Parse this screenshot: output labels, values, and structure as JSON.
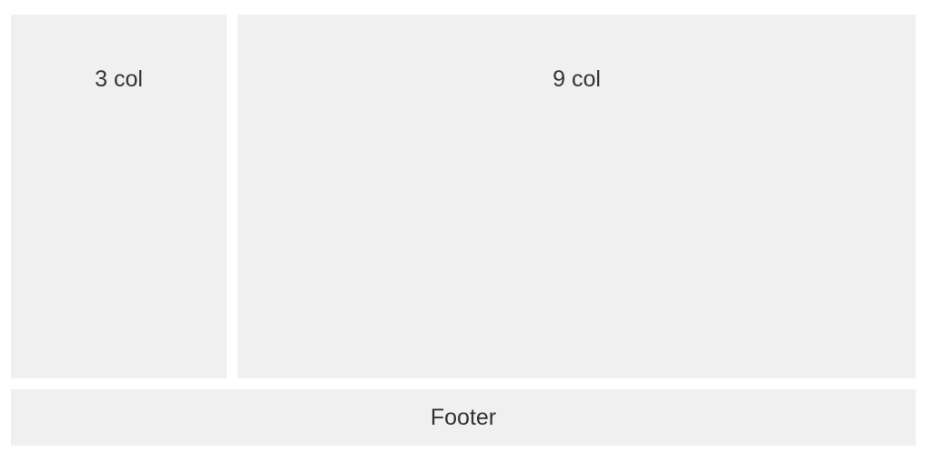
{
  "layout": {
    "left_panel_label": "3 col",
    "right_panel_label": "9 col",
    "footer_label": "Footer"
  }
}
